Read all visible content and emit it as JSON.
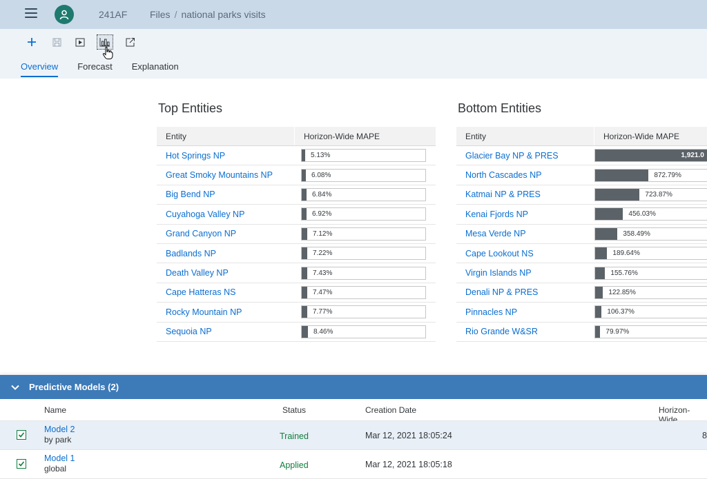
{
  "shell": {
    "app_id": "241AF",
    "breadcrumb": [
      "Files",
      "national parks visits"
    ],
    "breadcrumb_sep": "/"
  },
  "toolbar": {
    "icons": [
      "plus-icon",
      "save-icon",
      "play-icon",
      "chart-report-icon",
      "share-icon"
    ]
  },
  "tabs": [
    {
      "label": "Overview",
      "selected": true
    },
    {
      "label": "Forecast",
      "selected": false
    },
    {
      "label": "Explanation",
      "selected": false
    }
  ],
  "top_entities": {
    "title": "Top Entities",
    "col_entity": "Entity",
    "col_mape": "Horizon-Wide MAPE",
    "rows": [
      {
        "entity": "Hot Springs NP",
        "mape": 5.13,
        "label": "5.13%"
      },
      {
        "entity": "Great Smoky Mountains NP",
        "mape": 6.08,
        "label": "6.08%"
      },
      {
        "entity": "Big Bend NP",
        "mape": 6.84,
        "label": "6.84%"
      },
      {
        "entity": "Cuyahoga Valley NP",
        "mape": 6.92,
        "label": "6.92%"
      },
      {
        "entity": "Grand Canyon NP",
        "mape": 7.12,
        "label": "7.12%"
      },
      {
        "entity": "Badlands NP",
        "mape": 7.22,
        "label": "7.22%"
      },
      {
        "entity": "Death Valley NP",
        "mape": 7.43,
        "label": "7.43%"
      },
      {
        "entity": "Cape Hatteras NS",
        "mape": 7.47,
        "label": "7.47%"
      },
      {
        "entity": "Rocky Mountain NP",
        "mape": 7.77,
        "label": "7.77%"
      },
      {
        "entity": "Sequoia NP",
        "mape": 8.46,
        "label": "8.46%"
      }
    ]
  },
  "bottom_entities": {
    "title": "Bottom Entities",
    "col_entity": "Entity",
    "col_mape": "Horizon-Wide MAPE",
    "rows": [
      {
        "entity": "Glacier Bay NP & PRES",
        "mape": 1921,
        "label": "1,921.0"
      },
      {
        "entity": "North Cascades NP",
        "mape": 872.79,
        "label": "872.79%"
      },
      {
        "entity": "Katmai NP & PRES",
        "mape": 723.87,
        "label": "723.87%"
      },
      {
        "entity": "Kenai Fjords NP",
        "mape": 456.03,
        "label": "456.03%"
      },
      {
        "entity": "Mesa Verde NP",
        "mape": 358.49,
        "label": "358.49%"
      },
      {
        "entity": "Cape Lookout NS",
        "mape": 189.64,
        "label": "189.64%"
      },
      {
        "entity": "Virgin Islands NP",
        "mape": 155.76,
        "label": "155.76%"
      },
      {
        "entity": "Denali NP & PRES",
        "mape": 122.85,
        "label": "122.85%"
      },
      {
        "entity": "Pinnacles NP",
        "mape": 106.37,
        "label": "106.37%"
      },
      {
        "entity": "Rio Grande W&SR",
        "mape": 79.97,
        "label": "79.97%"
      }
    ]
  },
  "models": {
    "title": "Predictive Models (2)",
    "columns": {
      "name": "Name",
      "status": "Status",
      "date": "Creation Date",
      "mape": "Horizon-Wide"
    },
    "rows": [
      {
        "name": "Model 2",
        "sub": "by park",
        "status": "Trained",
        "date": "Mar 12, 2021 18:05:24",
        "value": "8",
        "checked": true,
        "selected": true
      },
      {
        "name": "Model 1",
        "sub": "global",
        "status": "Applied",
        "date": "Mar 12, 2021 18:05:18",
        "value": "",
        "checked": true,
        "selected": false
      }
    ]
  }
}
